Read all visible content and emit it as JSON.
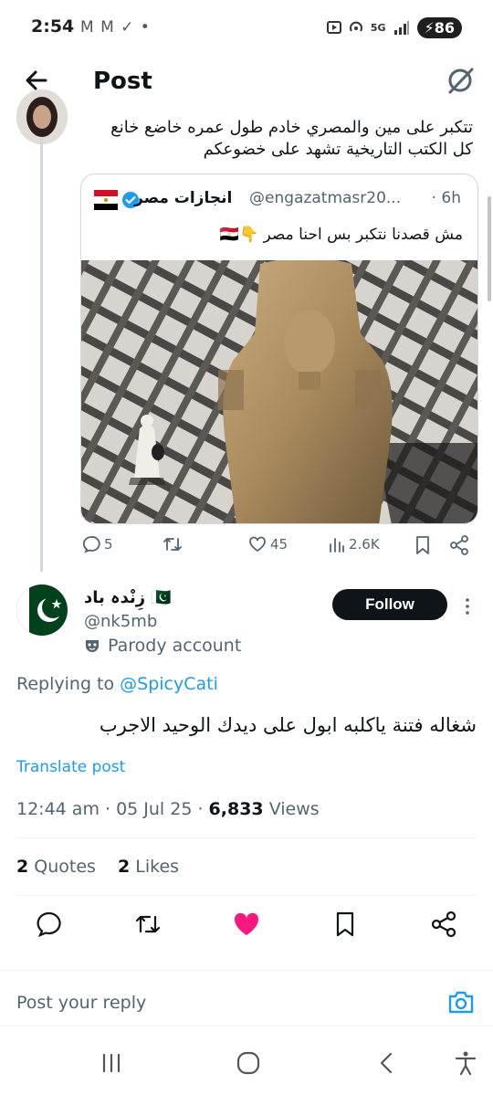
{
  "status_bar": {
    "time": "2:54",
    "left_icons": "M M ✓ •",
    "network": "5G",
    "battery": "86"
  },
  "header": {
    "title": "Post",
    "back_icon": "arrow-left-icon",
    "grok_icon": "grok-icon"
  },
  "parent_reply": {
    "text": "تتكبر على مين والمصري خادم طول عمره خاضع خانع كل الكتب التاريخية تشهد على خضوعكم"
  },
  "quoted_post": {
    "name": "انجازات مصر",
    "handle": "@engazatmasr20...",
    "time": "· 6h",
    "text": "مش قصدنا نتكبر بس احنا مصر 👇🇪🇬",
    "image_alt": "Statue of Ramesses II with a man in white robes walking on lattice-shadowed floor"
  },
  "parent_actions": {
    "replies": "5",
    "reposts": "",
    "likes": "45",
    "views": "2.6K"
  },
  "post": {
    "name": "زِنْدہ باد 🇵🇰",
    "handle": "@nk5mb",
    "parody_label": "Parody account",
    "follow_label": "Follow",
    "replying_prefix": "Replying to ",
    "replying_to": "@SpicyCati",
    "text": "شغاله فتنة ياكلبه ابول على ديدك الوحيد الاجرب",
    "translate": "Translate post",
    "time": "12:44 am · 05 Jul 25 · ",
    "views_count": "6,833",
    "views_label": " Views",
    "quotes_count": "2",
    "quotes_label": " Quotes",
    "likes_count": "2",
    "likes_label": " Likes"
  },
  "reply_box": {
    "placeholder": "Post your reply"
  },
  "colors": {
    "accent": "#1d9bf0",
    "like_pink": "#f91880",
    "text_primary": "#0f1419",
    "text_secondary": "#536471"
  }
}
